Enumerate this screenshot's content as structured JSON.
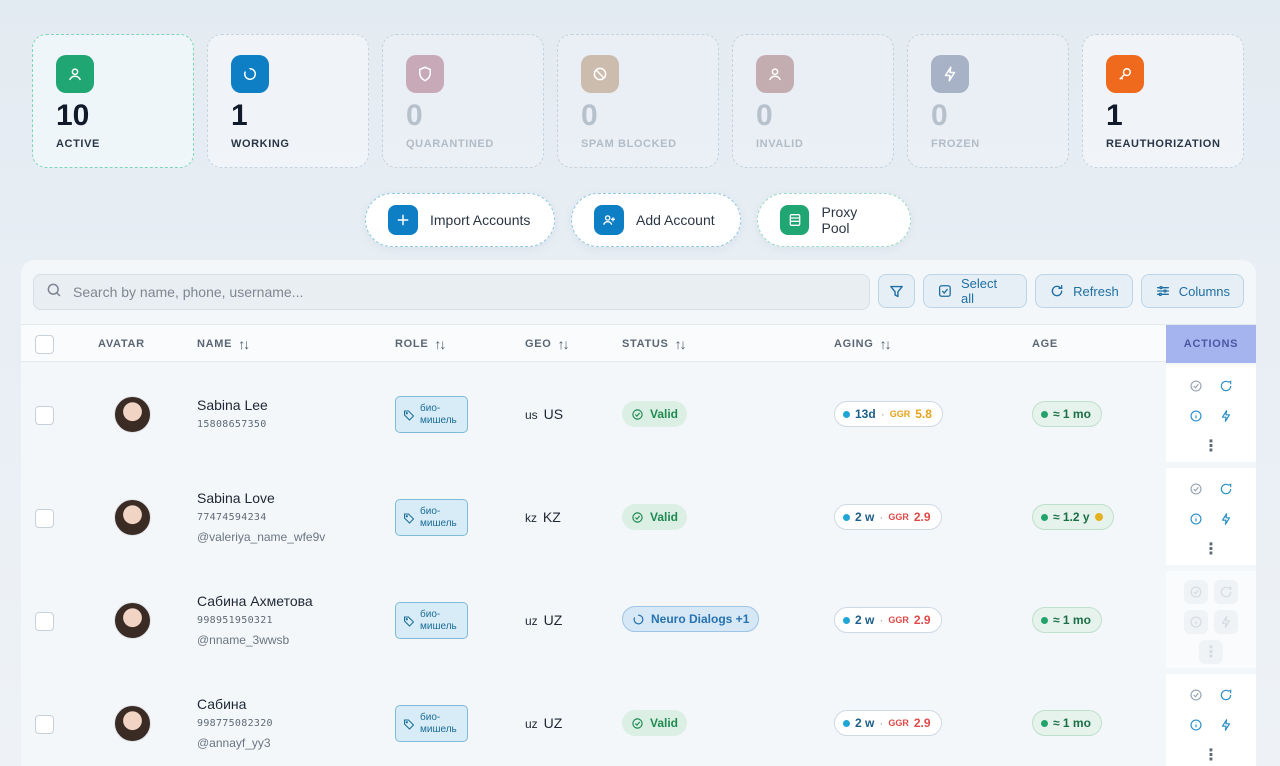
{
  "stats": [
    {
      "value": "10",
      "label": "ACTIVE"
    },
    {
      "value": "1",
      "label": "WORKING"
    },
    {
      "value": "0",
      "label": "QUARANTINED"
    },
    {
      "value": "0",
      "label": "SPAM BLOCKED"
    },
    {
      "value": "0",
      "label": "INVALID"
    },
    {
      "value": "0",
      "label": "FROZEN"
    },
    {
      "value": "1",
      "label": "REAUTHORIZATION"
    }
  ],
  "buttons": {
    "import": "Import Accounts",
    "add": "Add Account",
    "proxy": "Proxy Pool"
  },
  "toolbar": {
    "search_placeholder": "Search by name, phone, username...",
    "select_all": "Select all",
    "refresh": "Refresh",
    "columns": "Columns"
  },
  "columns": {
    "avatar": "AVATAR",
    "name": "NAME",
    "role": "ROLE",
    "geo": "GEO",
    "status": "STATUS",
    "aging": "AGING",
    "age": "AGE",
    "actions": "ACTIONS"
  },
  "rows": [
    {
      "name": "Sabina Lee",
      "phone": "15808657350",
      "username": "",
      "role": "био-мишель",
      "geo_code": "us",
      "geo": "US",
      "status": "Valid",
      "aging": "13d",
      "ggr_label": "GGR",
      "ggr": "5.8",
      "age": "≈ 1 mo"
    },
    {
      "name": "Sabina Love",
      "phone": "77474594234",
      "username": "@valeriya_name_wfe9v",
      "role": "био-мишель",
      "geo_code": "kz",
      "geo": "KZ",
      "status": "Valid",
      "aging": "2 w",
      "ggr_label": "GGR",
      "ggr": "2.9",
      "age": "≈ 1.2 y"
    },
    {
      "name": "Сабина Ахметова",
      "phone": "998951950321",
      "username": "@nname_3wwsb",
      "role": "био-мишель",
      "geo_code": "uz",
      "geo": "UZ",
      "status": "Neuro Dialogs +1",
      "aging": "2 w",
      "ggr_label": "GGR",
      "ggr": "2.9",
      "age": "≈ 1 mo"
    },
    {
      "name": "Сабина",
      "phone": "998775082320",
      "username": "@annayf_yy3",
      "role": "био-мишель",
      "geo_code": "uz",
      "geo": "UZ",
      "status": "Valid",
      "aging": "2 w",
      "ggr_label": "GGR",
      "ggr": "2.9",
      "age": "≈ 1 mo"
    }
  ],
  "colors": {
    "active": "#1fa672",
    "working": "#0e7fc4",
    "reauth": "#ef6a1c",
    "ggr_orange": "#e5a21a",
    "ggr_red": "#e04a4a"
  }
}
